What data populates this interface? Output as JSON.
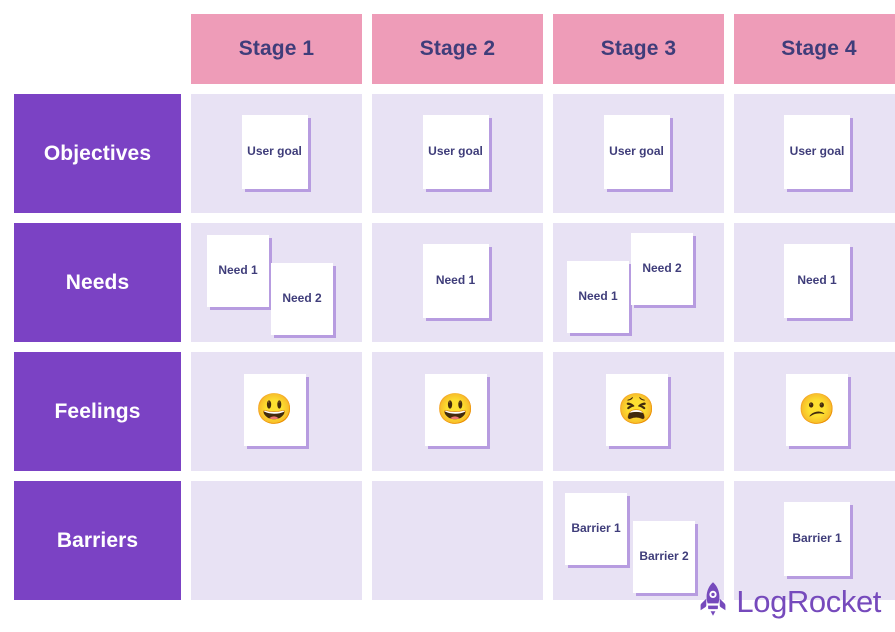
{
  "board": {
    "corner_label": "",
    "stages": [
      {
        "label": "Stage 1"
      },
      {
        "label": "Stage 2"
      },
      {
        "label": "Stage 3"
      },
      {
        "label": "Stage 4"
      }
    ],
    "rows": [
      {
        "label": "Objectives",
        "cells": [
          {
            "notes": [
              {
                "text": "User goal",
                "kind": "text"
              }
            ]
          },
          {
            "notes": [
              {
                "text": "User goal",
                "kind": "text"
              }
            ]
          },
          {
            "notes": [
              {
                "text": "User goal",
                "kind": "text"
              }
            ]
          },
          {
            "notes": [
              {
                "text": "User goal",
                "kind": "text"
              }
            ]
          }
        ]
      },
      {
        "label": "Needs",
        "cells": [
          {
            "notes": [
              {
                "text": "Need 1",
                "kind": "text"
              },
              {
                "text": "Need 2",
                "kind": "text"
              }
            ]
          },
          {
            "notes": [
              {
                "text": "Need 1",
                "kind": "text"
              }
            ]
          },
          {
            "notes": [
              {
                "text": "Need 1",
                "kind": "text"
              },
              {
                "text": "Need 2",
                "kind": "text"
              }
            ]
          },
          {
            "notes": [
              {
                "text": "Need 1",
                "kind": "text"
              }
            ]
          }
        ]
      },
      {
        "label": "Feelings",
        "cells": [
          {
            "notes": [
              {
                "text": "😃",
                "kind": "emoji",
                "icon": "grinning-face-emoji"
              }
            ]
          },
          {
            "notes": [
              {
                "text": "😃",
                "kind": "emoji",
                "icon": "grinning-face-emoji"
              }
            ]
          },
          {
            "notes": [
              {
                "text": "😫",
                "kind": "emoji",
                "icon": "distressed-face-emoji"
              }
            ]
          },
          {
            "notes": [
              {
                "text": "😕",
                "kind": "emoji",
                "icon": "confused-face-emoji"
              }
            ]
          }
        ]
      },
      {
        "label": "Barriers",
        "cells": [
          {
            "notes": []
          },
          {
            "notes": []
          },
          {
            "notes": [
              {
                "text": "Barrier 1",
                "kind": "text"
              },
              {
                "text": "Barrier 2",
                "kind": "text"
              }
            ]
          },
          {
            "notes": [
              {
                "text": "Barrier 1",
                "kind": "text"
              }
            ]
          }
        ]
      }
    ]
  },
  "logo": {
    "text": "LogRocket",
    "icon": "rocket-icon"
  },
  "colors": {
    "stage_header_bg": "#EE9CB8",
    "stage_header_text": "#3F3D7A",
    "row_header_bg": "#7B42C4",
    "row_header_text": "#FFFFFF",
    "cell_bg": "#E8E2F4",
    "note_bg": "#FFFFFF",
    "note_shadow": "#B79CE0",
    "note_text": "#3F3D7A",
    "logo_purple": "#764ABC",
    "page_bg": "#FFFFFF"
  }
}
